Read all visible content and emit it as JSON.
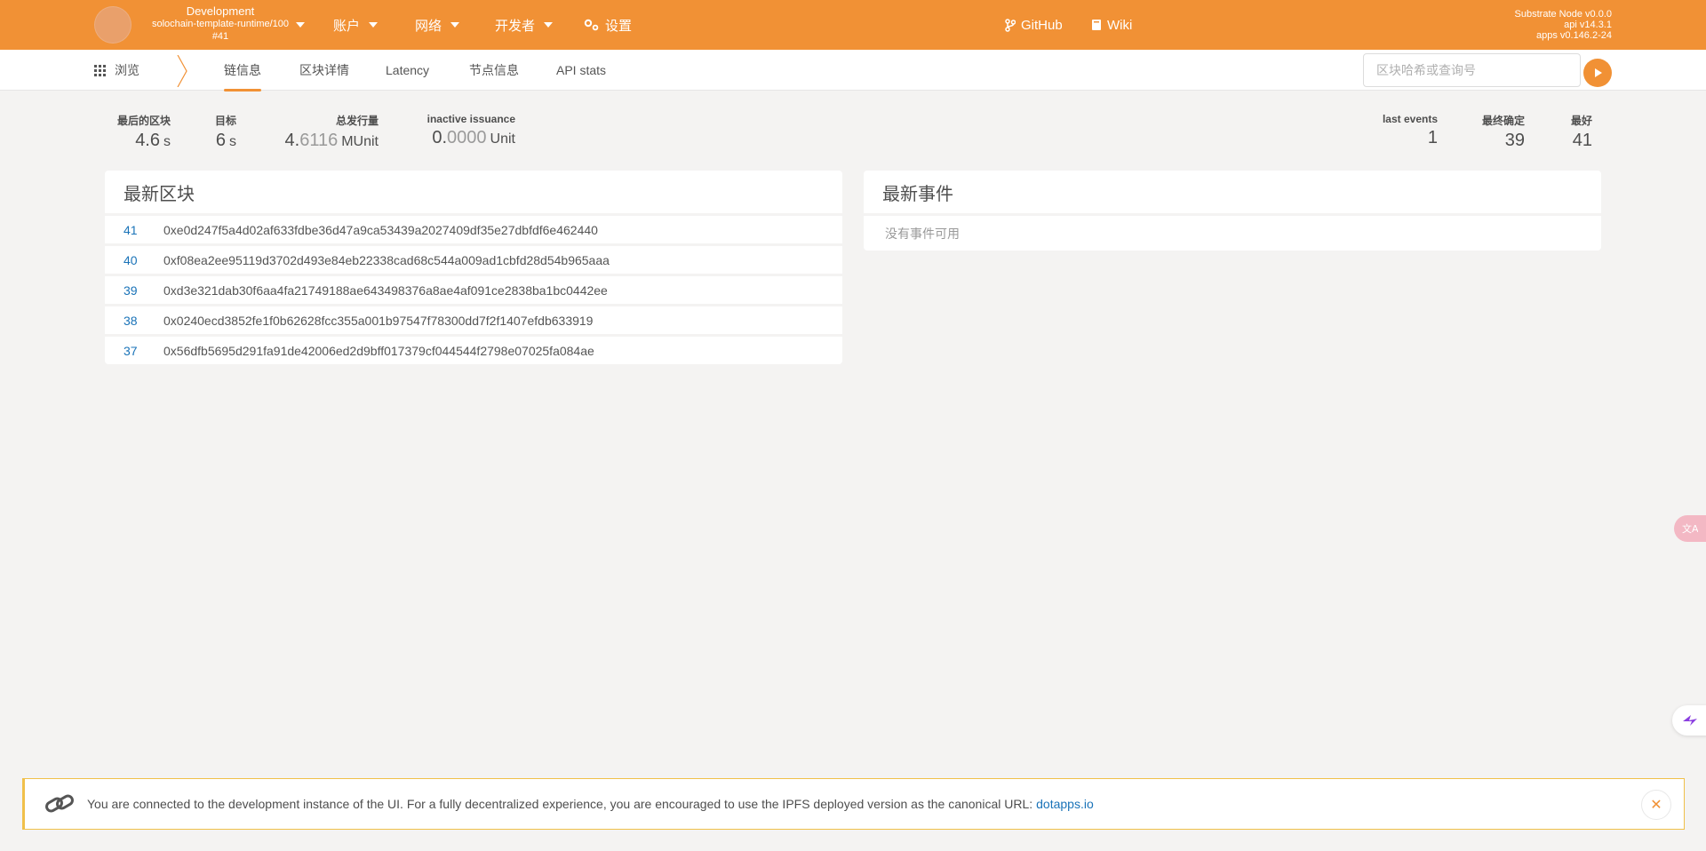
{
  "header": {
    "chain_name": "Development",
    "runtime": "solochain-template-runtime/100",
    "block": "#41",
    "menu": {
      "accounts": "账户",
      "network": "网络",
      "developer": "开发者",
      "settings": "设置",
      "github": "GitHub",
      "wiki": "Wiki"
    },
    "node_version": "Substrate Node v0.0.0",
    "api_version": "api v14.3.1",
    "apps_version": "apps v0.146.2-24"
  },
  "subnav": {
    "browse": "浏览",
    "tabs": [
      "链信息",
      "区块详情",
      "Latency",
      "节点信息",
      "API stats"
    ],
    "active_tab": "链信息",
    "search_placeholder": "区块哈希或查询号"
  },
  "summary": {
    "last_block": {
      "label": "最后的区块",
      "value": "4.6",
      "unit": "s"
    },
    "target": {
      "label": "目标",
      "value": "6",
      "unit": "s"
    },
    "total_issuance": {
      "label": "总发行量",
      "int": "4.",
      "frac": "6116",
      "unit": "MUnit"
    },
    "inactive_issuance": {
      "label": "inactive issuance",
      "int": "0.",
      "frac": "0000",
      "unit": "Unit"
    },
    "last_events": {
      "label": "last events",
      "value": "1"
    },
    "finalized": {
      "label": "最终确定",
      "value": "39"
    },
    "best": {
      "label": "最好",
      "value": "41"
    }
  },
  "recent_blocks": {
    "title": "最新区块",
    "rows": [
      {
        "number": "41",
        "hash": "0xe0d247f5a4d02af633fdbe36d47a9ca53439a2027409df35e27dbfdf6e462440"
      },
      {
        "number": "40",
        "hash": "0xf08ea2ee95119d3702d493e84eb22338cad68c544a009ad1cbfd28d54b965aaa"
      },
      {
        "number": "39",
        "hash": "0xd3e321dab30f6aa4fa21749188ae643498376a8ae4af091ce2838ba1bc0442ee"
      },
      {
        "number": "38",
        "hash": "0x0240ecd3852fe1f0b62628fcc355a001b97547f78300dd7f2f1407efdb633919"
      },
      {
        "number": "37",
        "hash": "0x56dfb5695d291fa91de42006ed2d9bff017379cf044544f2798e07025fa084ae"
      }
    ]
  },
  "recent_events": {
    "title": "最新事件",
    "empty": "没有事件可用"
  },
  "notice": {
    "text": "You are connected to the development instance of the UI. For a fully decentralized experience, you are encouraged to use the IPFS deployed version as the canonical URL:",
    "link": "dotapps.io",
    "close": "✕"
  },
  "colors": {
    "brand": "#f19135",
    "link": "#1a73b8",
    "notice_border": "#f0c04a"
  }
}
